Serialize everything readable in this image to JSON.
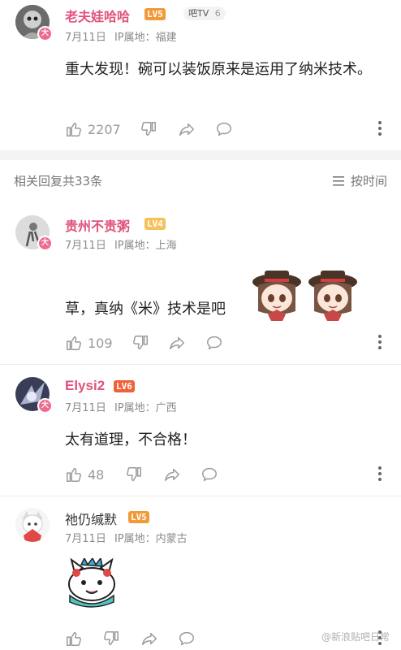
{
  "posts": [
    {
      "username": "老夫娃哈哈",
      "level": "LV5",
      "tag": "吧TV",
      "tag_count": "6",
      "date": "7月11日",
      "ip": "IP属地：福建",
      "text": "重大发现！碗可以装饭原来是运用了纳米技术。",
      "likes": "2207"
    }
  ],
  "section": {
    "count": "相关回复共33条",
    "sort": "按时间"
  },
  "replies": [
    {
      "username": "贵州不贵粥",
      "level": "LV4",
      "date": "7月11日",
      "ip": "IP属地：上海",
      "text": "草，真纳《米》技术是吧",
      "likes": "109"
    },
    {
      "username": "Elysi2",
      "level": "LV6",
      "date": "7月11日",
      "ip": "IP属地：广西",
      "text": "太有道理，不合格！",
      "likes": "48"
    },
    {
      "username": "祂仍缄默",
      "level": "LV5",
      "date": "7月11日",
      "ip": "IP属地：内蒙古",
      "text": "",
      "likes": ""
    }
  ],
  "watermark": "@新浪贴吧日常",
  "colors": {
    "name_pink": "#e0527c",
    "lv5": "#f29a38",
    "lv4": "#f6c15a",
    "lv6": "#f0603a",
    "name_gray": "#333333"
  }
}
